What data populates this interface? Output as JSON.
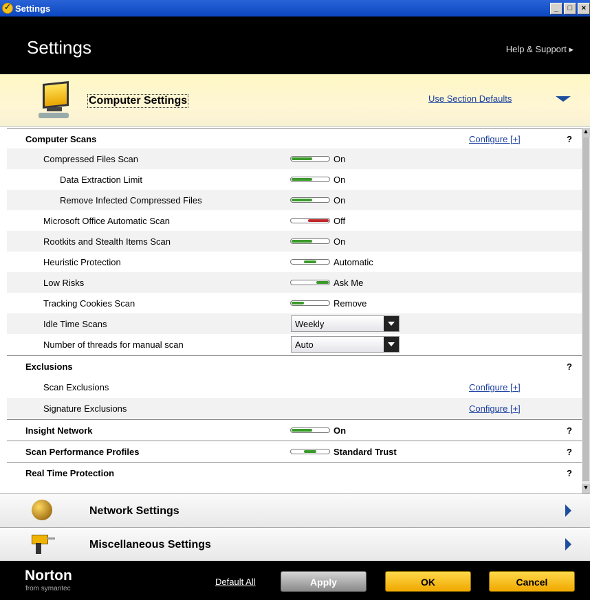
{
  "window": {
    "title": "Settings"
  },
  "header": {
    "title": "Settings",
    "help": "Help & Support ▸"
  },
  "section": {
    "title": "Computer Settings",
    "defaults": "Use Section Defaults"
  },
  "rows": [
    {
      "label": "Computer Scans",
      "group": true,
      "configure": "Configure [+]",
      "help": "?"
    },
    {
      "label": "Compressed Files Scan",
      "indent": 1,
      "switch": "on",
      "value": "On"
    },
    {
      "label": "Data Extraction Limit",
      "indent": 2,
      "switch": "on",
      "value": "On"
    },
    {
      "label": "Remove Infected Compressed Files",
      "indent": 2,
      "switch": "on",
      "value": "On"
    },
    {
      "label": "Microsoft Office Automatic Scan",
      "indent": 1,
      "switch": "off",
      "value": "Off"
    },
    {
      "label": "Rootkits and Stealth Items Scan",
      "indent": 1,
      "switch": "on",
      "value": "On"
    },
    {
      "label": "Heuristic Protection",
      "indent": 1,
      "switch": "mid",
      "value": "Automatic"
    },
    {
      "label": "Low Risks",
      "indent": 1,
      "switch": "right",
      "value": "Ask Me"
    },
    {
      "label": "Tracking Cookies Scan",
      "indent": 1,
      "switch": "left",
      "value": "Remove"
    },
    {
      "label": "Idle Time Scans",
      "indent": 1,
      "dropdown": "Weekly"
    },
    {
      "label": "Number of threads for manual scan",
      "indent": 1,
      "dropdown": "Auto"
    },
    {
      "label": "Exclusions",
      "group": true,
      "help": "?"
    },
    {
      "label": "Scan Exclusions",
      "indent": 1,
      "configure": "Configure [+]"
    },
    {
      "label": "Signature Exclusions",
      "indent": 1,
      "configure": "Configure [+]"
    },
    {
      "label": "Insight Network",
      "group": true,
      "switch": "on",
      "value": "On",
      "help": "?"
    },
    {
      "label": "Scan Performance Profiles",
      "group": true,
      "switch": "mid",
      "value": "Standard Trust",
      "help": "?"
    },
    {
      "label": "Real Time Protection",
      "group": true,
      "help": "?"
    }
  ],
  "panels": {
    "network": "Network Settings",
    "misc": "Miscellaneous Settings"
  },
  "footer": {
    "brand": "Norton",
    "sub": "from symantec",
    "default_all": "Default All",
    "apply": "Apply",
    "ok": "OK",
    "cancel": "Cancel"
  },
  "colors": {
    "on": "#3a9a2a",
    "off": "#c0282c"
  }
}
